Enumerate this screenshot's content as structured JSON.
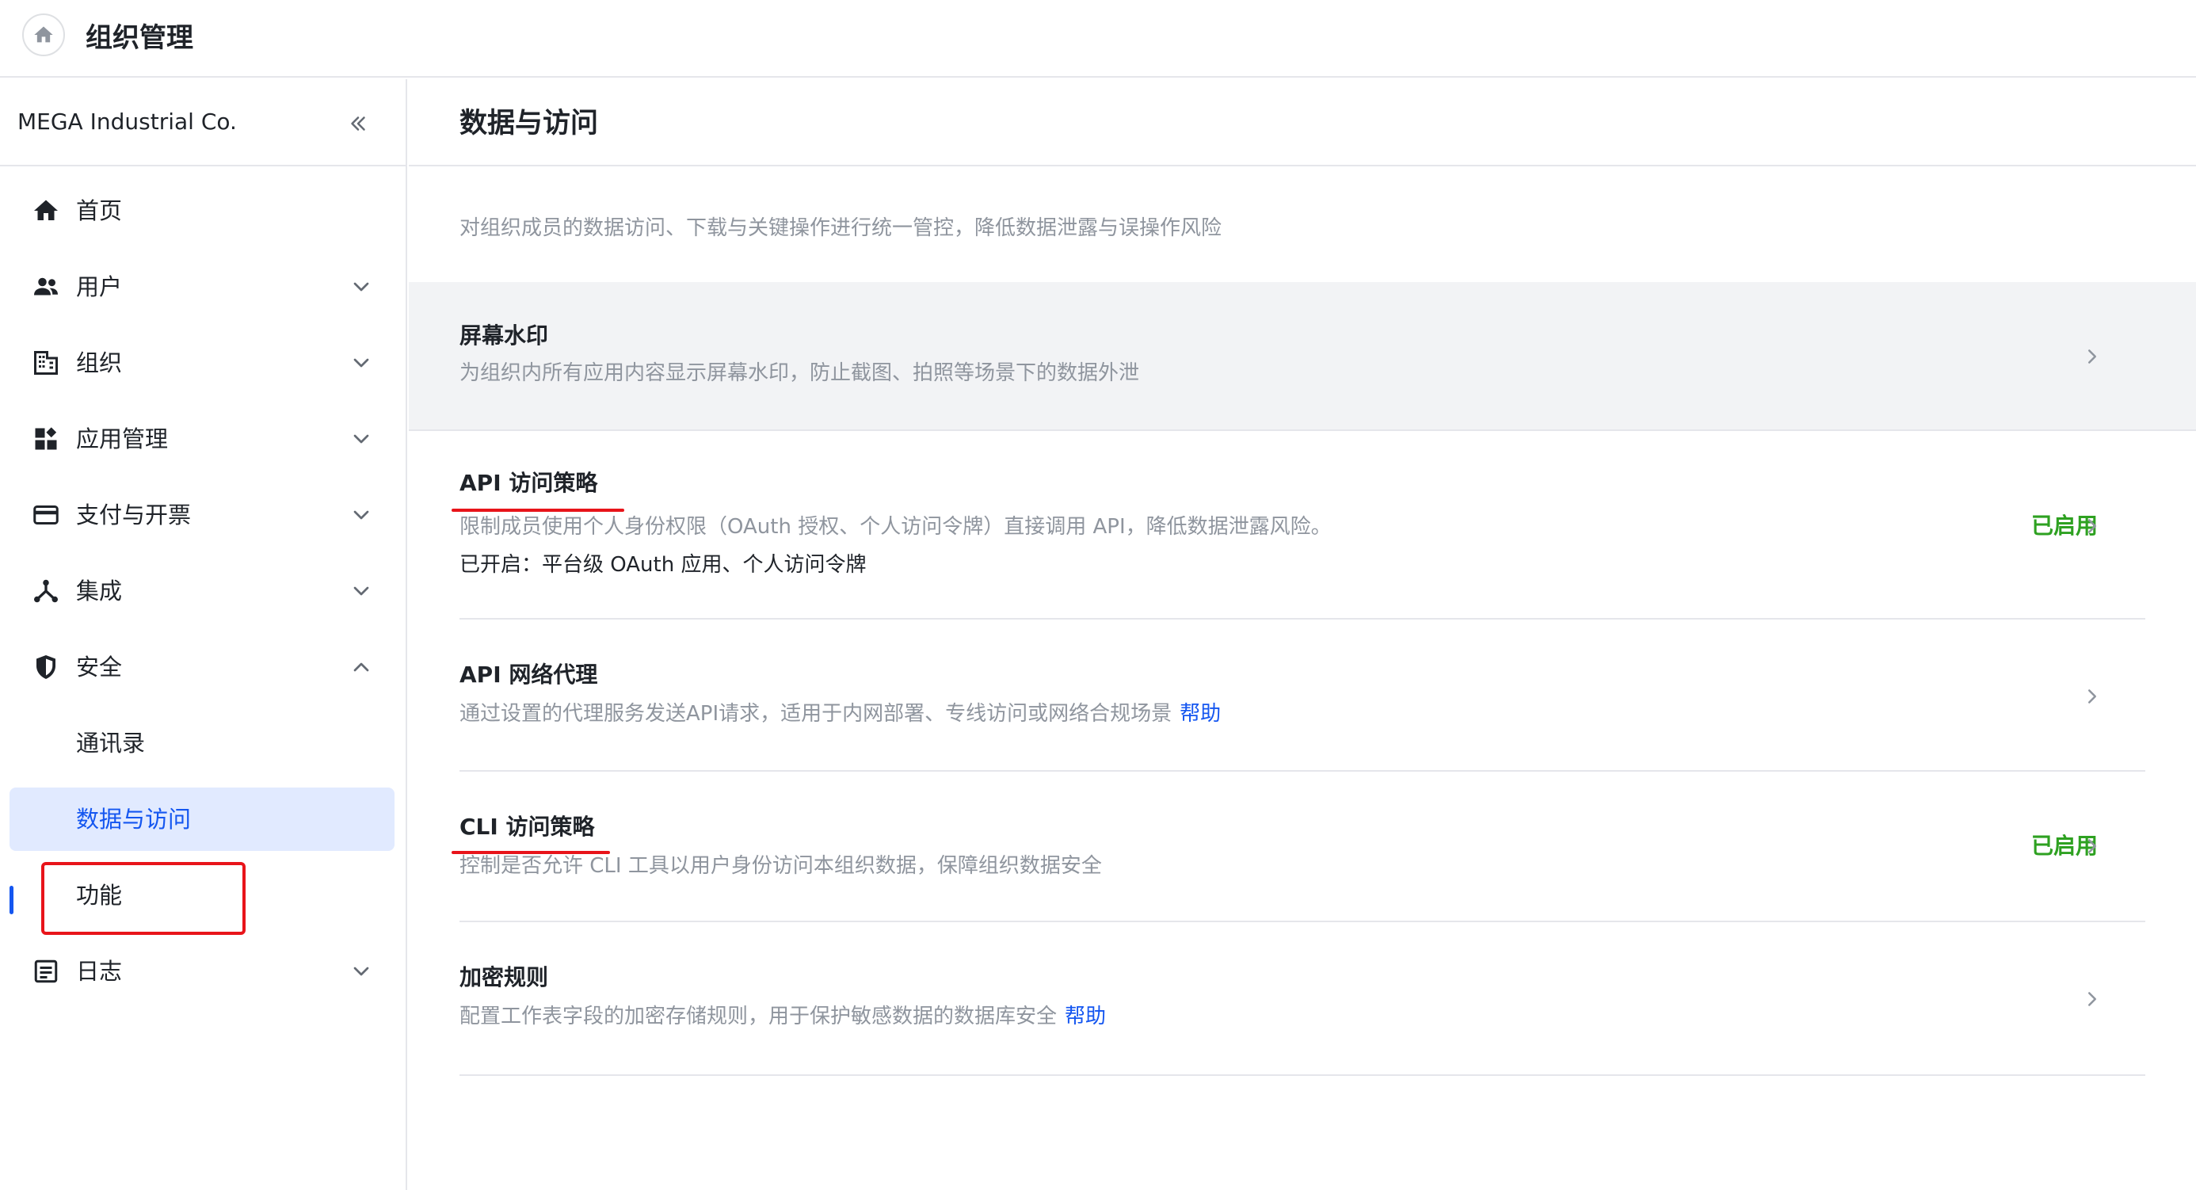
{
  "header": {
    "title": "组织管理",
    "home_icon": "home-icon"
  },
  "sidebar": {
    "org_name": "MEGA Industrial Co.",
    "collapse_icon": "double-chevron-left-icon",
    "items": [
      {
        "label": "首页",
        "icon": "home-icon",
        "expandable": false
      },
      {
        "label": "用户",
        "icon": "users-icon",
        "expandable": true
      },
      {
        "label": "组织",
        "icon": "building-icon",
        "expandable": true
      },
      {
        "label": "应用管理",
        "icon": "apps-icon",
        "expandable": true
      },
      {
        "label": "支付与开票",
        "icon": "credit-card-icon",
        "expandable": true
      },
      {
        "label": "集成",
        "icon": "integration-icon",
        "expandable": true
      },
      {
        "label": "安全",
        "icon": "shield-icon",
        "expandable": true,
        "expanded": true
      },
      {
        "label": "通讯录",
        "sub": true
      },
      {
        "label": "数据与访问",
        "sub": true,
        "active": true
      },
      {
        "label": "功能",
        "sub": true
      },
      {
        "label": "日志",
        "icon": "log-icon",
        "expandable": true
      }
    ]
  },
  "main": {
    "title": "数据与访问",
    "description": "对组织成员的数据访问、下载与关键操作进行统一管控，降低数据泄露与误操作风险",
    "rows": [
      {
        "title": "屏幕水印",
        "desc": "为组织内所有应用内容显示屏幕水印，防止截图、拍照等场景下的数据外泄",
        "status": "",
        "help": "",
        "extra": ""
      },
      {
        "title": "API 访问策略",
        "desc": "限制成员使用个人身份权限（OAuth 授权、个人访问令牌）直接调用 API，降低数据泄露风险。",
        "extra": "已开启：平台级 OAuth 应用、个人访问令牌",
        "status": "已启用",
        "help": ""
      },
      {
        "title": "API 网络代理",
        "desc": "通过设置的代理服务发送API请求，适用于内网部署、专线访问或网络合规场景",
        "help": "帮助",
        "status": "",
        "extra": ""
      },
      {
        "title": "CLI 访问策略",
        "desc": "控制是否允许 CLI 工具以用户身份访问本组织数据，保障组织数据安全",
        "status": "已启用",
        "help": "",
        "extra": ""
      },
      {
        "title": "加密规则",
        "desc": "配置工作表字段的加密存储规则，用于保护敏感数据的数据库安全",
        "help": "帮助",
        "status": "",
        "extra": ""
      }
    ]
  },
  "colors": {
    "accent": "#1456f0",
    "active_bg": "#e1eaff",
    "enabled": "#2ea121",
    "annotation": "#e8141a"
  }
}
